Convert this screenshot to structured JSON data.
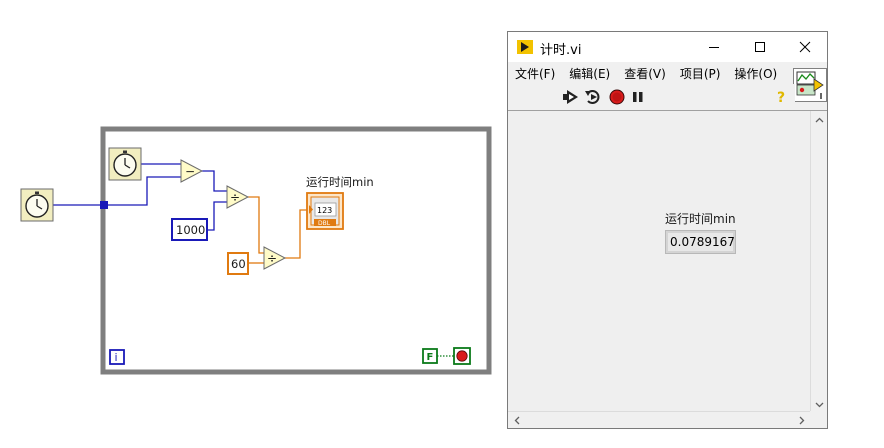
{
  "block_diagram": {
    "indicator_label": "运行时间min",
    "indicator_terminal_text": "123",
    "indicator_type": "DBL",
    "constant_1000": "1000",
    "constant_60": "60",
    "subtract_glyph": "−",
    "divide_glyph": "÷",
    "iteration_terminal": "i",
    "stop_constant": "F",
    "colors": {
      "loop_border": "#7f7f7f",
      "wire_int": "#1a1ab8",
      "wire_dbl": "#e07a10",
      "node_fill": "#fffbc8",
      "icon_fill": "#f2eec0"
    },
    "icons": [
      "tick-count-clock-icon",
      "tick-count-clock-icon",
      "stop-button-icon"
    ]
  },
  "front_panel": {
    "title": "计时.vi",
    "menu": [
      "文件(F)",
      "编辑(E)",
      "查看(V)",
      "项目(P)",
      "操作(O)"
    ],
    "indicator_label": "运行时间min",
    "indicator_value": "0.0789167",
    "toolbar_icons": [
      "run-arrow-icon",
      "run-continuously-icon",
      "abort-icon",
      "pause-icon"
    ],
    "help_icon": "context-help-icon",
    "window_buttons": [
      "minimize-icon",
      "maximize-icon",
      "close-icon"
    ]
  }
}
